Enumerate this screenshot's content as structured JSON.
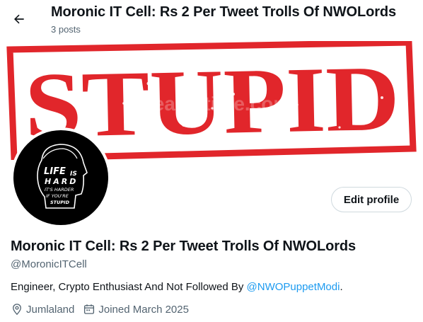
{
  "header": {
    "title": "Moronic IT Cell: Rs 2 Per Tweet Trolls Of NWOLords",
    "post_count": "3 posts"
  },
  "banner": {
    "text": "STUPID",
    "watermark": "dreamstime.com",
    "stamp_color": "#e1262b"
  },
  "avatar": {
    "lines": [
      "LIFE",
      "IS",
      "HARD",
      "IT'S HARDER",
      "IF YOU'RE",
      "STUPID"
    ]
  },
  "profile": {
    "edit_label": "Edit profile",
    "display_name": "Moronic IT Cell: Rs 2 Per Tweet Trolls Of NWOLords",
    "handle": "@MoronicITCell",
    "bio_prefix": "Engineer, Crypto Enthusiast And Not Followed By ",
    "bio_mention": "@NWOPuppetModi",
    "bio_suffix": ".",
    "location": "Jumlaland",
    "joined": "Joined March 2025"
  },
  "colors": {
    "link": "#1d9bf0",
    "muted": "#536471",
    "text": "#0f1419"
  }
}
